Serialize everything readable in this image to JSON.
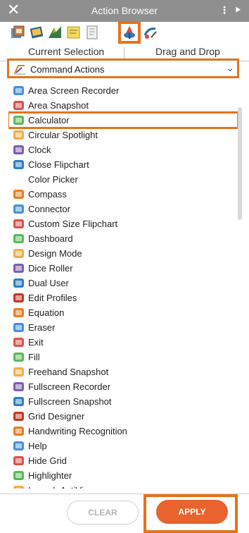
{
  "window": {
    "title": "Action Browser",
    "close_glyph": "✕",
    "menu_glyph": "⋮",
    "pin_glyph": "⯈"
  },
  "icon_tabs": [
    {
      "name": "resource-icon"
    },
    {
      "name": "pages-icon"
    },
    {
      "name": "annotations-icon"
    },
    {
      "name": "notes-icon"
    },
    {
      "name": "flipchart-icon"
    },
    {
      "name": "actions-icon",
      "active": true
    },
    {
      "name": "property-icon"
    }
  ],
  "modes": {
    "current": "Current Selection",
    "dnd": "Drag and Drop"
  },
  "category": {
    "label": "Command Actions"
  },
  "items": [
    {
      "label": "Area Screen Recorder",
      "icon": "area-screen-recorder-icon"
    },
    {
      "label": "Area Snapshot",
      "icon": "area-snapshot-icon"
    },
    {
      "label": "Calculator",
      "icon": "calculator-icon",
      "selected": true
    },
    {
      "label": "Circular Spotlight",
      "icon": "circular-spotlight-icon"
    },
    {
      "label": "Clock",
      "icon": "clock-icon"
    },
    {
      "label": "Close Flipchart",
      "icon": "close-flipchart-icon"
    },
    {
      "label": "Color Picker",
      "icon": ""
    },
    {
      "label": "Compass",
      "icon": "compass-icon"
    },
    {
      "label": "Connector",
      "icon": "connector-icon"
    },
    {
      "label": "Custom Size Flipchart",
      "icon": "custom-size-flipchart-icon"
    },
    {
      "label": "Dashboard",
      "icon": "dashboard-icon"
    },
    {
      "label": "Design Mode",
      "icon": "design-mode-icon"
    },
    {
      "label": "Dice Roller",
      "icon": "dice-roller-icon"
    },
    {
      "label": "Dual User",
      "icon": "dual-user-icon"
    },
    {
      "label": "Edit Profiles",
      "icon": "edit-profiles-icon"
    },
    {
      "label": "Equation",
      "icon": "equation-icon"
    },
    {
      "label": "Eraser",
      "icon": "eraser-icon"
    },
    {
      "label": "Exit",
      "icon": "exit-icon"
    },
    {
      "label": "Fill",
      "icon": "fill-icon"
    },
    {
      "label": "Freehand Snapshot",
      "icon": "freehand-snapshot-icon"
    },
    {
      "label": "Fullscreen Recorder",
      "icon": "fullscreen-recorder-icon"
    },
    {
      "label": "Fullscreen Snapshot",
      "icon": "fullscreen-snapshot-icon"
    },
    {
      "label": "Grid Designer",
      "icon": "grid-designer-icon"
    },
    {
      "label": "Handwriting Recognition",
      "icon": "handwriting-recognition-icon"
    },
    {
      "label": "Help",
      "icon": "help-icon"
    },
    {
      "label": "Hide Grid",
      "icon": "hide-grid-icon"
    },
    {
      "label": "Highlighter",
      "icon": "highlighter-icon"
    },
    {
      "label": "Launch ActiView",
      "icon": "launch-actiview-icon"
    }
  ],
  "buttons": {
    "clear": "CLEAR",
    "apply": "APPLY"
  },
  "colors": {
    "accent": "#e6731b",
    "apply_bg": "#e8632e",
    "titlebar": "#8f8f8f"
  }
}
